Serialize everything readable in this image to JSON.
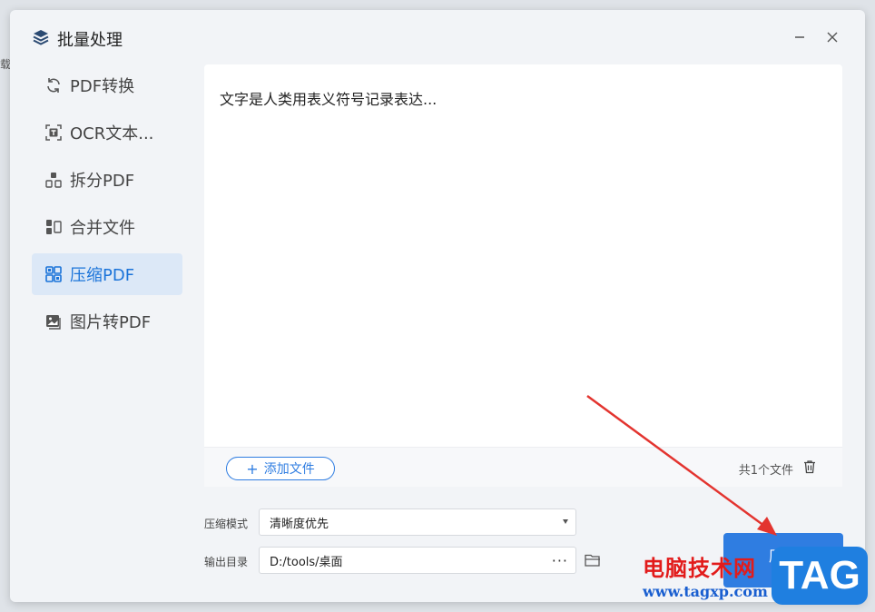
{
  "background": {
    "fragment": "载信"
  },
  "window": {
    "title": "批量处理",
    "title_icon": "layers-icon",
    "minimize_icon": "minimize-icon",
    "close_icon": "close-icon"
  },
  "sidebar": {
    "items": [
      {
        "label": "PDF转换",
        "icon": "refresh-icon",
        "active": false
      },
      {
        "label": "OCR文本...",
        "icon": "ocr-text-icon",
        "active": false
      },
      {
        "label": "拆分PDF",
        "icon": "split-icon",
        "active": false
      },
      {
        "label": "合并文件",
        "icon": "merge-icon",
        "active": false
      },
      {
        "label": "压缩PDF",
        "icon": "compress-icon",
        "active": true
      },
      {
        "label": "图片转PDF",
        "icon": "image-icon",
        "active": false
      }
    ]
  },
  "file_panel": {
    "file_name": "文字是人类用表义符号记录表达...",
    "add_button": "添加文件",
    "file_count": "共1个文件"
  },
  "form": {
    "mode_label": "压缩模式",
    "mode_value": "清晰度优先",
    "output_label": "输出目录",
    "output_value": "D:/tools/桌面",
    "browse_dots": "···"
  },
  "start_button": {
    "label": "压缩"
  },
  "watermark": {
    "cn": "电脑技术网",
    "url": "www.tagxp.com",
    "tag": "TAG"
  },
  "colors": {
    "accent": "#2f7de1",
    "active_bg": "#dce8f7",
    "arrow": "#e3342f"
  }
}
